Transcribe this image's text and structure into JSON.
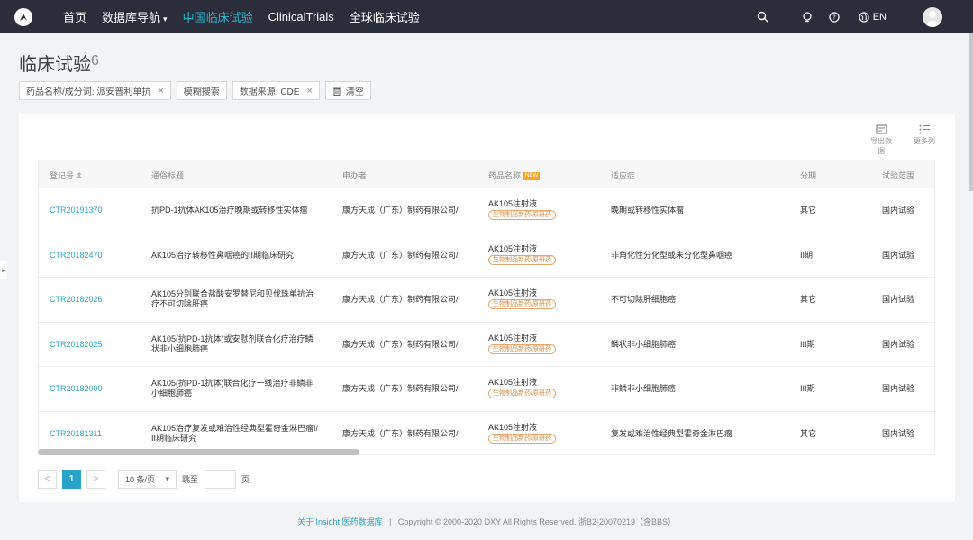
{
  "nav": {
    "items": [
      {
        "label": "首页",
        "active": false
      },
      {
        "label": "数据库导航",
        "active": false,
        "dropdown": true
      },
      {
        "label": "中国临床试验",
        "active": true
      },
      {
        "label": "ClinicalTrials",
        "active": false
      },
      {
        "label": "全球临床试验",
        "active": false
      }
    ],
    "lang_label": "EN",
    "icons": [
      "search-icon",
      "lightbulb-icon",
      "help-icon",
      "globe-icon"
    ],
    "accent": "#29b6d0"
  },
  "page": {
    "title": "临床试验",
    "count": "6"
  },
  "filters": [
    {
      "label": "药品名称/成分词: 派安普利单抗",
      "closable": true
    },
    {
      "label": "模糊搜索",
      "closable": false
    },
    {
      "label": "数据来源: CDE",
      "closable": true
    }
  ],
  "clear_label": "清空",
  "tools": {
    "export_label": "导出数据",
    "more_label": "更多列"
  },
  "table": {
    "columns": {
      "id": "登记号",
      "title": "通俗标题",
      "sponsor": "申办者",
      "drug": "药品名称",
      "new_badge": "NEW",
      "indication": "适应症",
      "phase": "分期",
      "scope": "试验范围"
    },
    "rows": [
      {
        "id": "CTR20191370",
        "title_lines": [
          "抗PD-1抗体AK105治疗晚期或转移性实体瘤"
        ],
        "sponsor": "康方天成（广东）制药有限公司/",
        "drug": "AK105注射液",
        "drug_tag": "生物制品新药/原研药",
        "indication": "晚期或转移性实体瘤",
        "phase": "其它",
        "scope": "国内试验"
      },
      {
        "id": "CTR20182470",
        "title_lines": [
          "AK105治疗转移性鼻咽癌的II期临床研究"
        ],
        "sponsor": "康方天成（广东）制药有限公司/",
        "drug": "AK105注射液",
        "drug_tag": "生物制品新药/原研药",
        "indication": "非角化性分化型或未分化型鼻咽癌",
        "phase": "II期",
        "scope": "国内试验"
      },
      {
        "id": "CTR20182026",
        "title_lines": [
          "AK105分别联合盐酸安罗替尼和贝伐珠单抗治",
          "疗不可切除肝癌"
        ],
        "sponsor": "康方天成（广东）制药有限公司/",
        "drug": "AK105注射液",
        "drug_tag": "生物制品新药/原研药",
        "indication": "不可切除肝细胞癌",
        "phase": "其它",
        "scope": "国内试验"
      },
      {
        "id": "CTR20182025",
        "title_lines": [
          "AK105(抗PD-1抗体)或安慰剂联合化疗治疗鳞",
          "状非小细胞肺癌"
        ],
        "sponsor": "康方天成（广东）制药有限公司/",
        "drug": "AK105注射液",
        "drug_tag": "生物制品新药/原研药",
        "indication": "鳞状非小细胞肺癌",
        "phase": "III期",
        "scope": "国内试验"
      },
      {
        "id": "CTR20182009",
        "title_lines": [
          "AK105(抗PD-1抗体)联合化疗一线治疗非鳞非",
          "小细胞肺癌"
        ],
        "sponsor": "康方天成（广东）制药有限公司/",
        "drug": "AK105注射液",
        "drug_tag": "生物制品新药/原研药",
        "indication": "非鳞非小细胞肺癌",
        "phase": "III期",
        "scope": "国内试验"
      },
      {
        "id": "CTR20181311",
        "title_lines": [
          "AK105治疗复发或难治性经典型霍奇金淋巴瘤I/",
          "II期临床研究"
        ],
        "sponsor": "康方天成（广东）制药有限公司/",
        "drug": "AK105注射液",
        "drug_tag": "生物制品新药/原研药",
        "indication": "复发或难治性经典型霍奇金淋巴瘤",
        "phase": "其它",
        "scope": "国内试验"
      }
    ]
  },
  "pagination": {
    "prev": "<",
    "current": "1",
    "next": ">",
    "page_size": "10 条/页",
    "jump_label": "跳至",
    "page_label": "页"
  },
  "footer": {
    "link": "关于 Insight 医药数据库",
    "separator": "|",
    "copyright": "Copyright © 2000-2020 DXY All Rights Reserved. 浙B2-20070219（含BBS）"
  }
}
